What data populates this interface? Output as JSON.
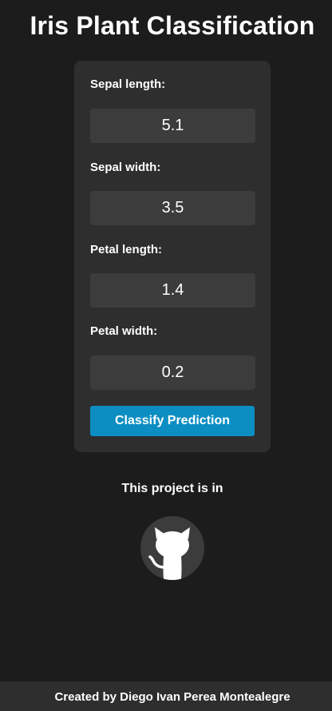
{
  "header": {
    "title": "Iris Plant Classification"
  },
  "form": {
    "fields": [
      {
        "label": "Sepal length:",
        "value": "5.1"
      },
      {
        "label": "Sepal width:",
        "value": "3.5"
      },
      {
        "label": "Petal length:",
        "value": "1.4"
      },
      {
        "label": "Petal width:",
        "value": "0.2"
      }
    ],
    "submit_label": "Classify Prediction"
  },
  "project": {
    "text": "This project is in",
    "icon": "github-octocat-icon"
  },
  "footer": {
    "text": "Created by Diego Ivan Perea Montealegre"
  },
  "colors": {
    "background": "#1c1c1c",
    "card": "#2e2e2e",
    "input": "#3c3c3c",
    "accent": "#0c8ec2"
  }
}
